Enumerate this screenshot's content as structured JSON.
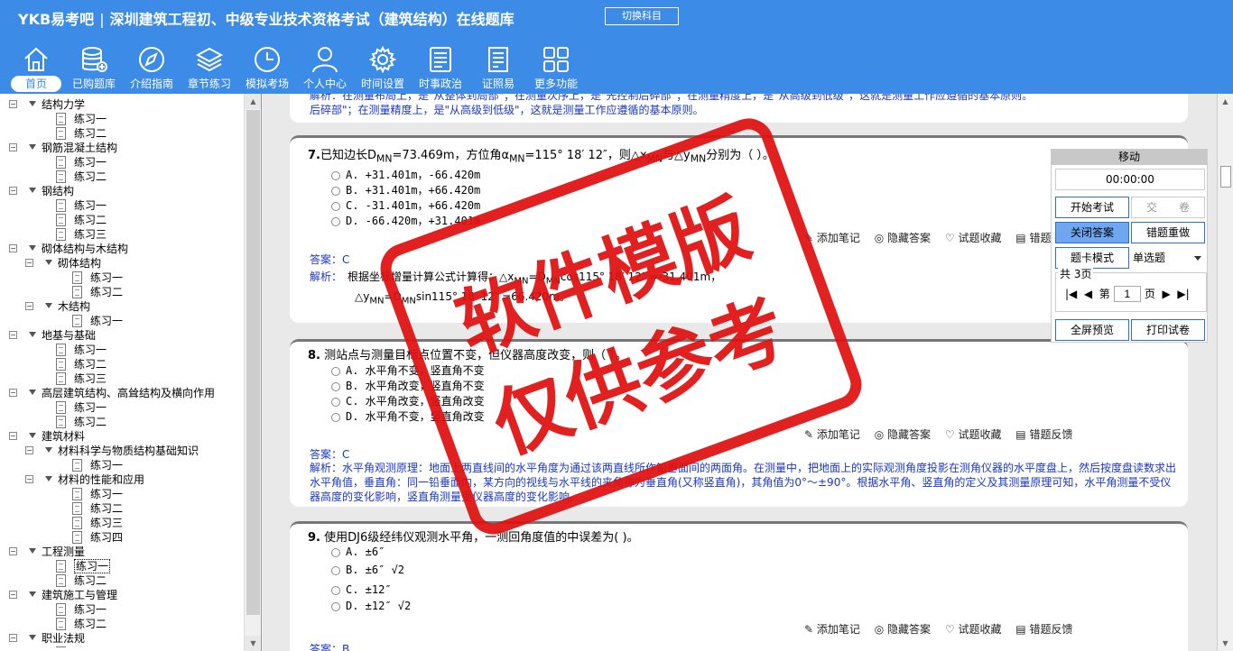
{
  "header": {
    "logo": "YKB易考吧",
    "title": "深圳建筑工程初、中级专业技术资格考试（建筑结构）在线题库",
    "switch_label": "切换科目"
  },
  "nav": [
    {
      "label": "首页",
      "icon": "home-icon"
    },
    {
      "label": "已购题库",
      "icon": "database-icon"
    },
    {
      "label": "介绍指南",
      "icon": "compass-icon"
    },
    {
      "label": "章节练习",
      "icon": "layers-icon"
    },
    {
      "label": "模拟考场",
      "icon": "clock-icon"
    },
    {
      "label": "个人中心",
      "icon": "user-icon"
    },
    {
      "label": "时间设置",
      "icon": "gear-icon"
    },
    {
      "label": "时事政治",
      "icon": "newspaper-icon"
    },
    {
      "label": "证照易",
      "icon": "certificate-icon"
    },
    {
      "label": "更多功能",
      "icon": "grid-icon"
    }
  ],
  "tree": [
    {
      "label": "结构力学",
      "level": 0,
      "type": "folder"
    },
    {
      "label": "练习一",
      "level": 1,
      "type": "doc"
    },
    {
      "label": "练习二",
      "level": 1,
      "type": "doc"
    },
    {
      "label": "钢筋混凝土结构",
      "level": 0,
      "type": "folder"
    },
    {
      "label": "练习一",
      "level": 1,
      "type": "doc"
    },
    {
      "label": "练习二",
      "level": 1,
      "type": "doc"
    },
    {
      "label": "钢结构",
      "level": 0,
      "type": "folder"
    },
    {
      "label": "练习一",
      "level": 1,
      "type": "doc"
    },
    {
      "label": "练习二",
      "level": 1,
      "type": "doc"
    },
    {
      "label": "练习三",
      "level": 1,
      "type": "doc"
    },
    {
      "label": "砌体结构与木结构",
      "level": 0,
      "type": "folder"
    },
    {
      "label": "砌体结构",
      "level": 1,
      "type": "folder"
    },
    {
      "label": "练习一",
      "level": 2,
      "type": "doc"
    },
    {
      "label": "练习二",
      "level": 2,
      "type": "doc"
    },
    {
      "label": "木结构",
      "level": 1,
      "type": "folder"
    },
    {
      "label": "练习一",
      "level": 2,
      "type": "doc"
    },
    {
      "label": "地基与基础",
      "level": 0,
      "type": "folder"
    },
    {
      "label": "练习一",
      "level": 1,
      "type": "doc"
    },
    {
      "label": "练习二",
      "level": 1,
      "type": "doc"
    },
    {
      "label": "练习三",
      "level": 1,
      "type": "doc"
    },
    {
      "label": "高层建筑结构、高耸结构及横向作用",
      "level": 0,
      "type": "folder"
    },
    {
      "label": "练习一",
      "level": 1,
      "type": "doc"
    },
    {
      "label": "练习二",
      "level": 1,
      "type": "doc"
    },
    {
      "label": "建筑材料",
      "level": 0,
      "type": "folder"
    },
    {
      "label": "材料科学与物质结构基础知识",
      "level": 1,
      "type": "folder"
    },
    {
      "label": "练习一",
      "level": 2,
      "type": "doc"
    },
    {
      "label": "材料的性能和应用",
      "level": 1,
      "type": "folder"
    },
    {
      "label": "练习一",
      "level": 2,
      "type": "doc"
    },
    {
      "label": "练习二",
      "level": 2,
      "type": "doc"
    },
    {
      "label": "练习三",
      "level": 2,
      "type": "doc"
    },
    {
      "label": "练习四",
      "level": 2,
      "type": "doc"
    },
    {
      "label": "工程测量",
      "level": 0,
      "type": "folder"
    },
    {
      "label": "练习一",
      "level": 1,
      "type": "doc",
      "selected": true
    },
    {
      "label": "练习二",
      "level": 1,
      "type": "doc"
    },
    {
      "label": "建筑施工与管理",
      "level": 0,
      "type": "folder"
    },
    {
      "label": "练习一",
      "level": 1,
      "type": "doc"
    },
    {
      "label": "练习二",
      "level": 1,
      "type": "doc"
    },
    {
      "label": "职业法规",
      "level": 0,
      "type": "folder"
    },
    {
      "label": "练习一",
      "level": 1,
      "type": "doc"
    }
  ],
  "prev_explanation": {
    "line1": "解析：在测量布局上，是\"从整体到局部\"；在测量次序上，是\"先控制后碎部\"；在测量精度上，是\"从高级到低级\"，这就是测量工作应遵循的基本原则。",
    "line2": "后碎部\"；在测量精度上，是\"从高级到低级\"，这就是测量工作应遵循的基本原则。"
  },
  "tools": {
    "note": "添加笔记",
    "hide": "隐藏答案",
    "fav": "试题收藏",
    "report": "错题反馈"
  },
  "q7": {
    "num": "7.",
    "text": "已知边长D",
    "sub1": "MN",
    "text2": "=73.469m，方位角α",
    "sub2": "MN",
    "text3": "=115° 18′ 12″，则△x",
    "sub3": "MN",
    "text4": "与△y",
    "sub4": "MN",
    "text5": "分别为（  ）。",
    "options": [
      "A. +31.401m，-66.420m",
      "B. +31.401m，+66.420m",
      "C. -31.401m，+66.420m",
      "D. -66.420m，+31.401m"
    ],
    "answer": "答案：C",
    "exp_label": "解析：",
    "exp1": "根据坐标增量计算公式计算得：△x",
    "exp1_sub": "MN",
    "exp1_b": "=D",
    "exp1_b_sub": "MN",
    "exp1_c": "cos115° 18′ 12″ =-31.401m，",
    "exp2": "△y",
    "exp2_sub": "MN",
    "exp2_b": "=D",
    "exp2_b_sub": "MN",
    "exp2_c": "sin115° 18′ 12″ =66.420m。"
  },
  "q8": {
    "num": "8.",
    "text": "测站点与测量目标点位置不变，但仪器高度改变，则（  ）。",
    "options": [
      "A. 水平角不变，竖直角不变",
      "B. 水平角改变，竖直角不变",
      "C. 水平角改变，竖直角改变",
      "D. 水平角不变，竖直角改变"
    ],
    "answer": "答案：C",
    "exp": "解析：水平角观测原理：地面上两直线间的水平角度为通过该两直线所作铅垂面间的两面角。在测量中，把地面上的实际观测角度投影在测角仪器的水平度盘上，然后按度盘读数求出水平角值，垂直角：同一铅垂面内，某方向的视线与水平线的夹角称为垂直角(又称竖直角)，其角值为0°～±90°。根据水平角、竖直角的定义及其测量原理可知，水平角测量不受仪器高度的变化影响，竖直角测量受仪器高度的变化影响。"
  },
  "q9": {
    "num": "9.",
    "text": "使用DJ6级经纬仪观测水平角，一测回角度值的中误差为( )。",
    "options": [
      "A. ±6″",
      "B. ±6″ √2",
      "C. ±12″",
      "D. ±12″ √2"
    ],
    "answer": "答案：B"
  },
  "panel": {
    "move": "移动",
    "timer": "00:00:00",
    "start": "开始考试",
    "submit": "交　　卷",
    "close_answer": "关闭答案",
    "redo": "错题重做",
    "card_mode": "题卡模式",
    "mode_value": "单选题",
    "total": "共 3页",
    "page_prefix": "第",
    "page_value": "1",
    "page_suffix": "页",
    "fullscreen": "全屏预览",
    "print": "打印试卷"
  },
  "watermark": {
    "line1": "软件模版",
    "line2": "仅供参考"
  },
  "colors": {
    "header": "#3c8be6",
    "answer": "#1a37c8",
    "watermark": "#e01010"
  }
}
